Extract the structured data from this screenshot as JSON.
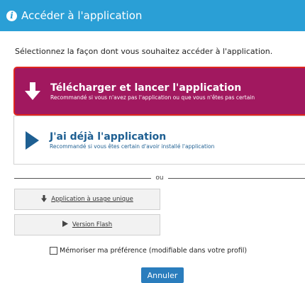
{
  "dialog": {
    "title": "Accéder à l'application",
    "intro": "Sélectionnez la façon dont vous souhaitez accéder à l'application."
  },
  "options": {
    "download": {
      "title": "Télécharger et lancer l'application",
      "subtitle": "Recommandé si vous n'avez pas l'application ou que vous n'êtes pas certain"
    },
    "already": {
      "title": "J'ai déjà l'application",
      "subtitle": "Recommandé si vous êtes certain d'avoir installé l'application"
    }
  },
  "separator": {
    "label": "ou"
  },
  "alternatives": {
    "single_use": "Application à usage unique",
    "flash": "Version Flash"
  },
  "remember": {
    "label": "Mémoriser ma préférence (modifiable dans votre profil)",
    "checked": false
  },
  "cancel_label": "Annuler",
  "colors": {
    "header": "#2a9fd6",
    "primary_option": "#a1185f",
    "primary_border": "#e0261e",
    "secondary_text": "#1e5f92",
    "cancel_button": "#2a7dbd"
  },
  "icons": {
    "header": "info-icon",
    "download": "arrow-down-icon",
    "already": "play-icon",
    "single_use": "arrow-down-icon",
    "flash": "play-icon"
  }
}
